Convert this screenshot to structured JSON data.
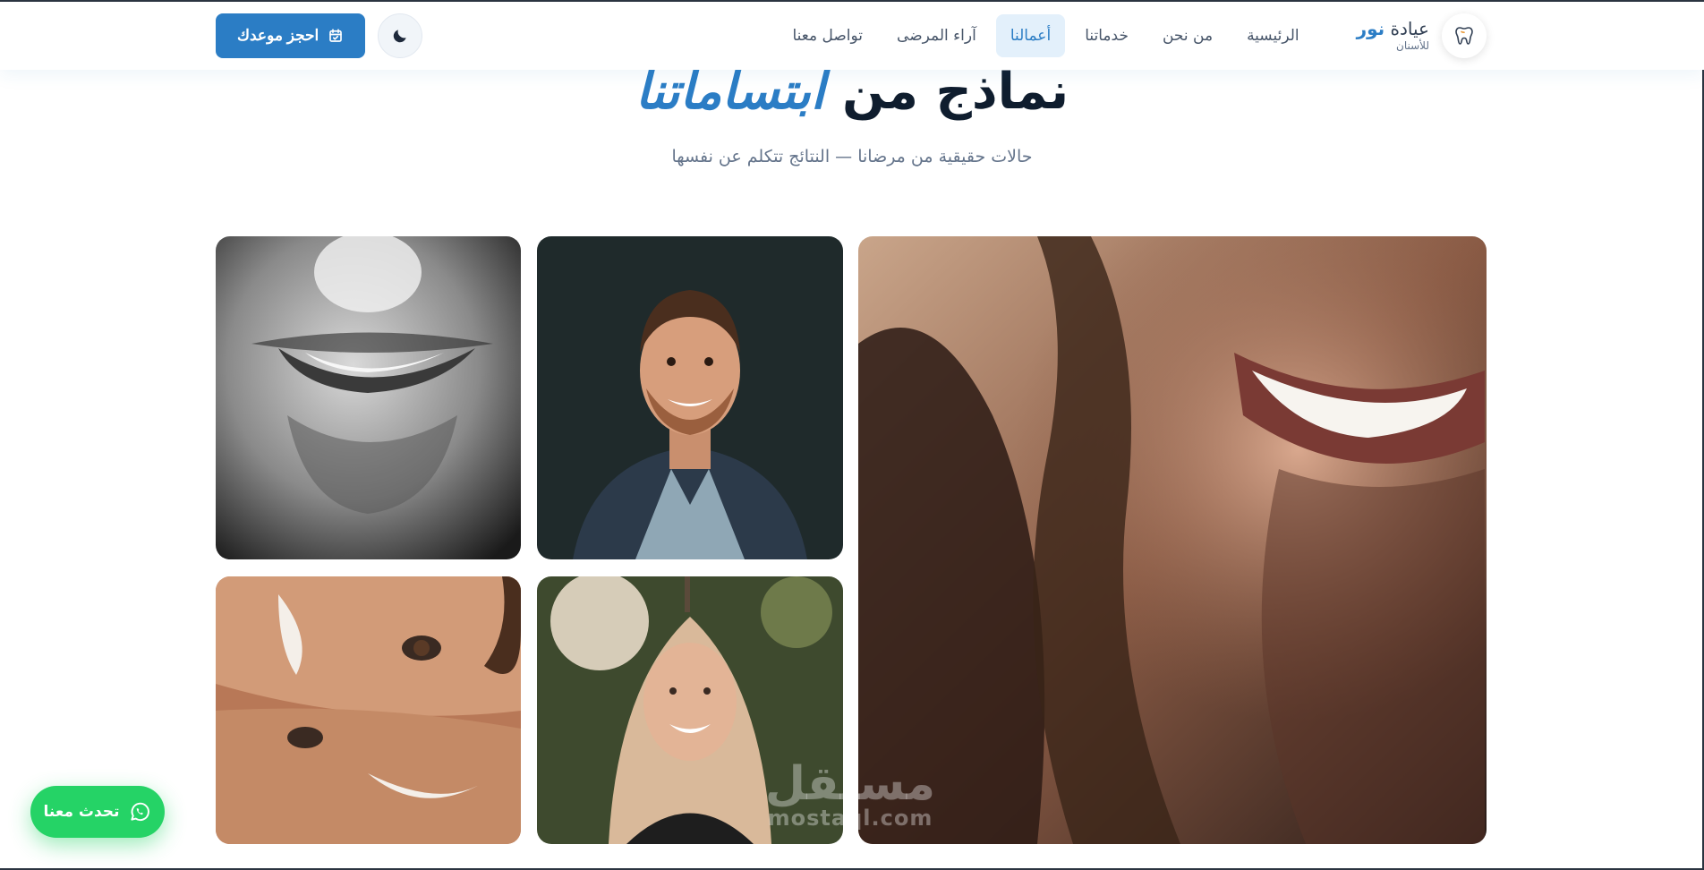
{
  "brand": {
    "name_prefix": "عيادة",
    "name_accent": "نور",
    "subtitle": "للأسنان",
    "logo_icon": "tooth-icon"
  },
  "nav": {
    "items": [
      {
        "label": "الرئيسية",
        "active": false
      },
      {
        "label": "من نحن",
        "active": false
      },
      {
        "label": "خدماتنا",
        "active": false
      },
      {
        "label": "أعمالنا",
        "active": true
      },
      {
        "label": "آراء المرضى",
        "active": false
      },
      {
        "label": "تواصل معنا",
        "active": false
      }
    ]
  },
  "actions": {
    "theme_icon": "moon-icon",
    "book_label": "احجز موعدك",
    "book_icon": "calendar-check-icon"
  },
  "section": {
    "title_main": "نماذج من",
    "title_accent": "ابتساماتنا",
    "subtitle": "حالات حقيقية من مرضانا — النتائج تتكلم عن نفسها"
  },
  "gallery": {
    "tiles": [
      {
        "name": "smile-closeup-bw",
        "description": "black and white close-up of a man smiling"
      },
      {
        "name": "man-portrait",
        "description": "portrait of a smiling man with a beard"
      },
      {
        "name": "woman-laughing-large",
        "description": "close-up of a laughing woman with dark hair"
      },
      {
        "name": "couple-smiling",
        "description": "two faces smiling together"
      },
      {
        "name": "woman-portrait",
        "description": "portrait of a smiling blonde woman outdoors"
      }
    ]
  },
  "watermark": {
    "arabic": "مستقل",
    "latin": "mostaql.com"
  },
  "chat": {
    "label": "تحدث معنا",
    "icon": "whatsapp-icon"
  },
  "colors": {
    "accent": "#2b7dc5",
    "whatsapp": "#25d366",
    "title": "#0f1d2e"
  }
}
